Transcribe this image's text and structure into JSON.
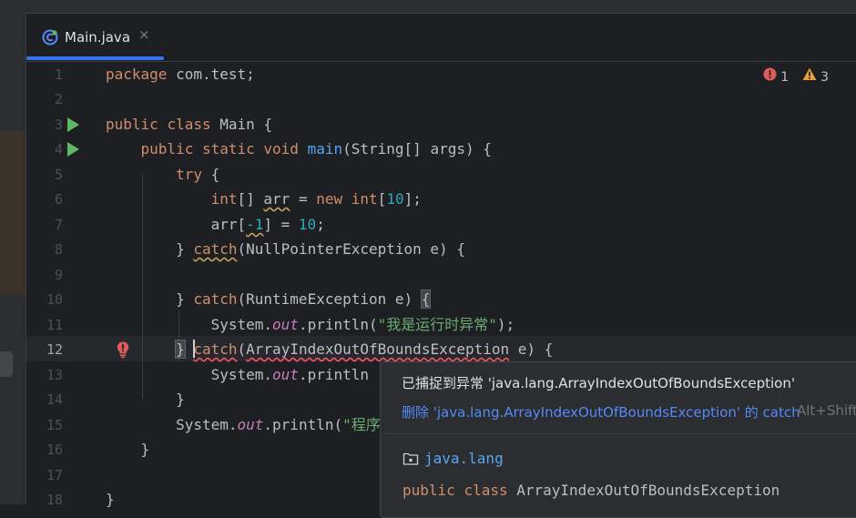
{
  "tab": {
    "filename": "Main.java",
    "close": "×"
  },
  "inspections": {
    "errors": "1",
    "warnings": "3",
    "colors": {
      "error": "#db5c5c",
      "warning": "#e8a33e"
    }
  },
  "line_numbers": [
    "1",
    "2",
    "3",
    "4",
    "5",
    "6",
    "7",
    "8",
    "9",
    "10",
    "11",
    "12",
    "13",
    "14",
    "15",
    "16",
    "17",
    "18"
  ],
  "code": {
    "l1": {
      "kw": "package",
      "rest": " com.test;"
    },
    "l3": {
      "kw1": "public",
      "kw2": "class",
      "rest": " Main {"
    },
    "l4": {
      "kw1": "public",
      "kw2": "static",
      "kw3": "void",
      "name": "main",
      "rest": "(String[] args) {"
    },
    "l5": {
      "kw": "try",
      "rest": " {"
    },
    "l6": {
      "kw1": "int",
      "a": "[] ",
      "var": "arr",
      "b": " = ",
      "kw2": "new",
      "c": " ",
      "kw3": "int",
      "d": "[",
      "num": "10",
      "e": "];"
    },
    "l7": {
      "a": "arr[",
      "num": "-1",
      "b": "] = ",
      "num2": "10",
      "c": ";"
    },
    "l8": {
      "a": "} ",
      "kw": "catch",
      "b": "(NullPointerException e) {"
    },
    "l10": {
      "a": "} ",
      "kw": "catch",
      "b": "(RuntimeException e) ",
      "brace": "{"
    },
    "l11": {
      "a": "System.",
      "fld": "out",
      "b": ".println(",
      "str": "\"我是运行时异常\"",
      "c": ");"
    },
    "l12": {
      "brace": "}",
      "a": " ",
      "kw": "catch",
      "b": "(",
      "exc": "ArrayIndexOutOfBoundsException",
      "c": " e) {"
    },
    "l13": {
      "a": "System.",
      "fld": "out",
      "b": ".println"
    },
    "l14": {
      "a": "}"
    },
    "l15": {
      "a": "System.",
      "fld": "out",
      "b": ".println(",
      "str": "\"程序"
    },
    "l16": {
      "a": "}"
    },
    "l18": {
      "a": "}"
    }
  },
  "popup": {
    "title": "已捕捉到异常 'java.lang.ArrayIndexOutOfBoundsException'",
    "action": "删除 'java.lang.ArrayIndexOutOfBoundsException' 的 catch",
    "shortcut": "Alt+Shift",
    "package": "java.lang",
    "decl_kw1": "public",
    "decl_kw2": "class",
    "decl_name": "ArrayIndexOutOfBoundsException"
  }
}
